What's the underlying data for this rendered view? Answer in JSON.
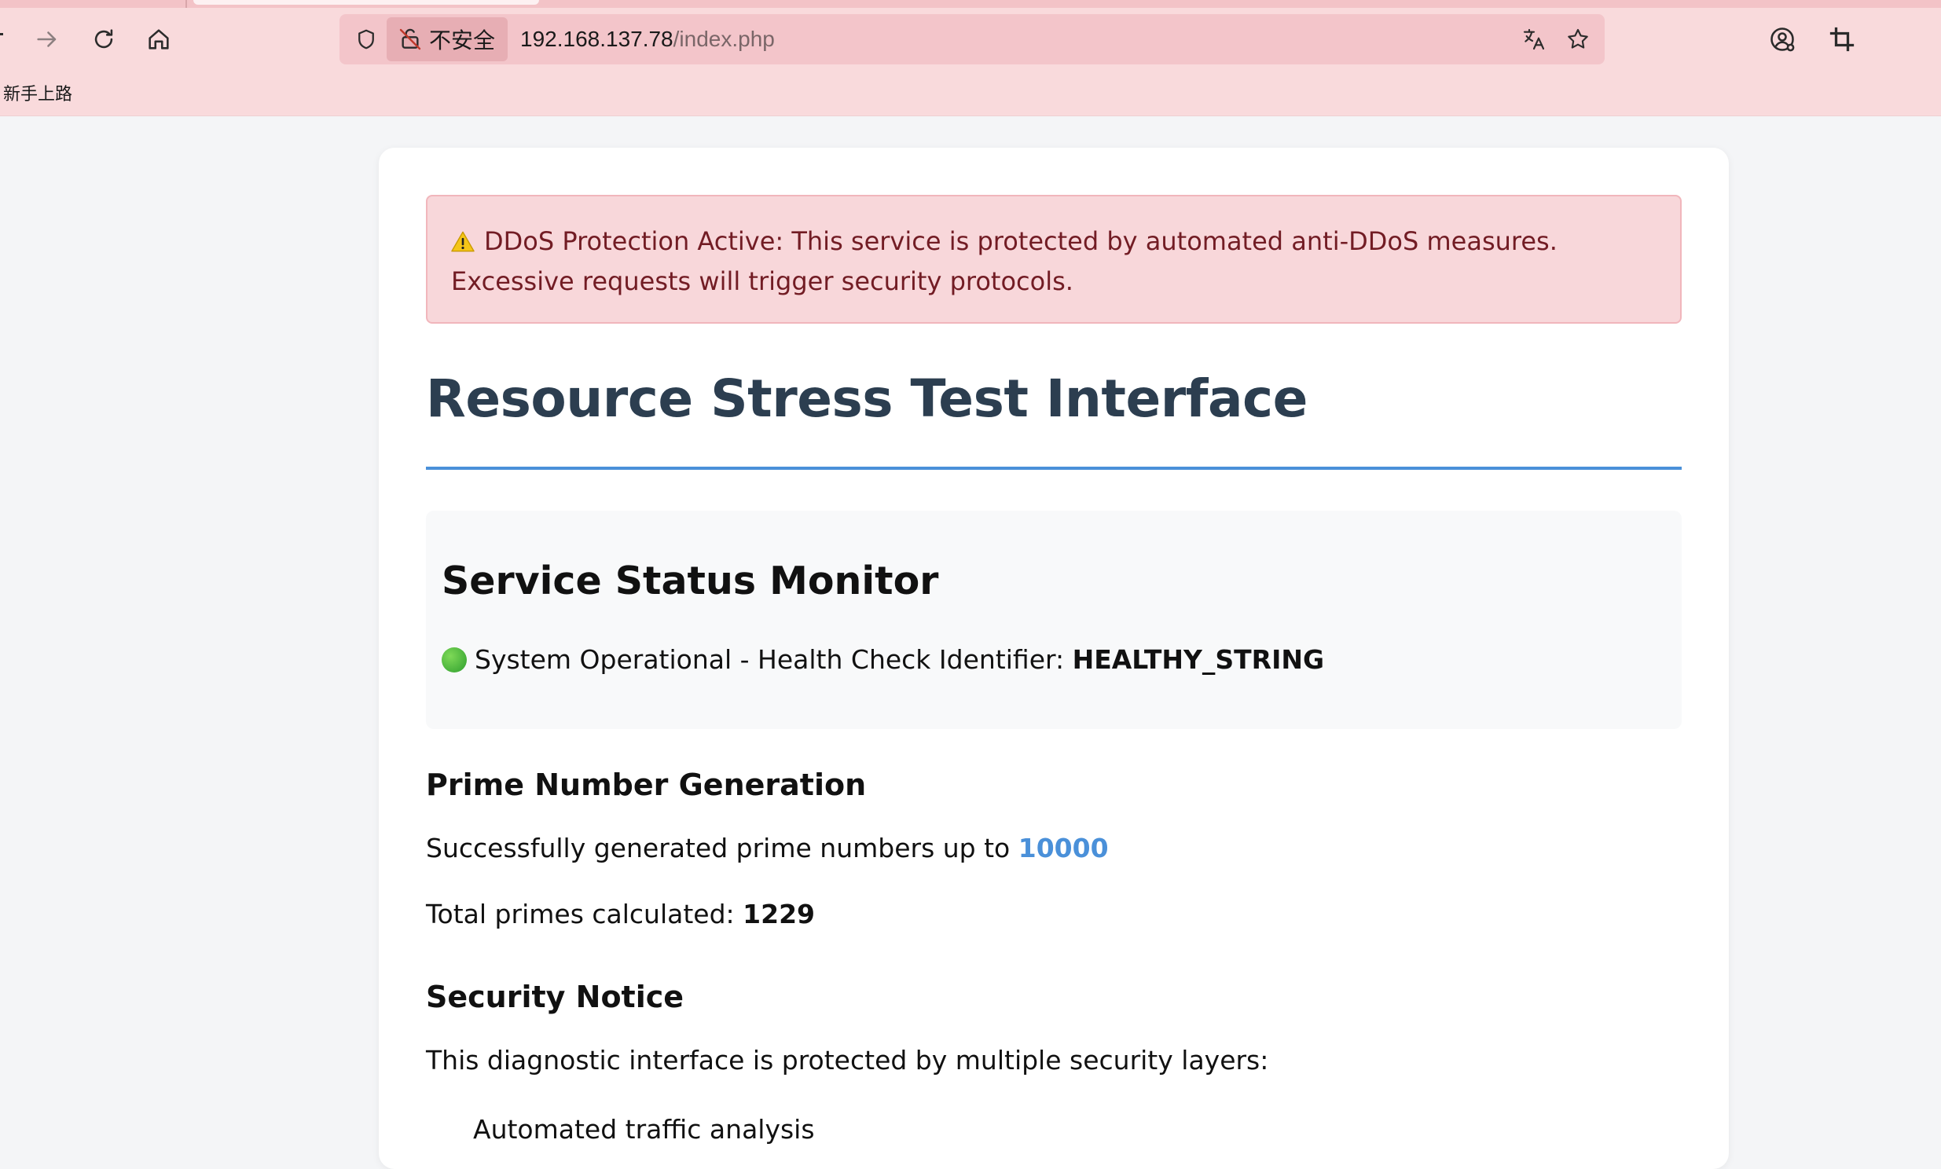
{
  "browser": {
    "insecure_label": "不安全",
    "url_host": "192.168.137.78",
    "url_path": "/index.php",
    "bookmark_label": "新手上路"
  },
  "alert": {
    "icon": "warning-icon",
    "text": "DDoS Protection Active: This service is protected by automated anti-DDoS measures. Excessive requests will trigger security protocols."
  },
  "page": {
    "title": "Resource Stress Test Interface",
    "accent_color": "#4a90d9",
    "title_color": "#2c3e50"
  },
  "status": {
    "heading": "Service Status Monitor",
    "indicator_icon": "green-circle-icon",
    "text_prefix": "System Operational - Health Check Identifier: ",
    "identifier": "HEALTHY_STRING"
  },
  "primes": {
    "heading": "Prime Number Generation",
    "generated_prefix": "Successfully generated prime numbers up to ",
    "limit": "10000",
    "total_prefix": "Total primes calculated: ",
    "total": "1229"
  },
  "security": {
    "heading": "Security Notice",
    "intro": "This diagnostic interface is protected by multiple security layers:",
    "first_item_partial": "Automated traffic analysis"
  }
}
